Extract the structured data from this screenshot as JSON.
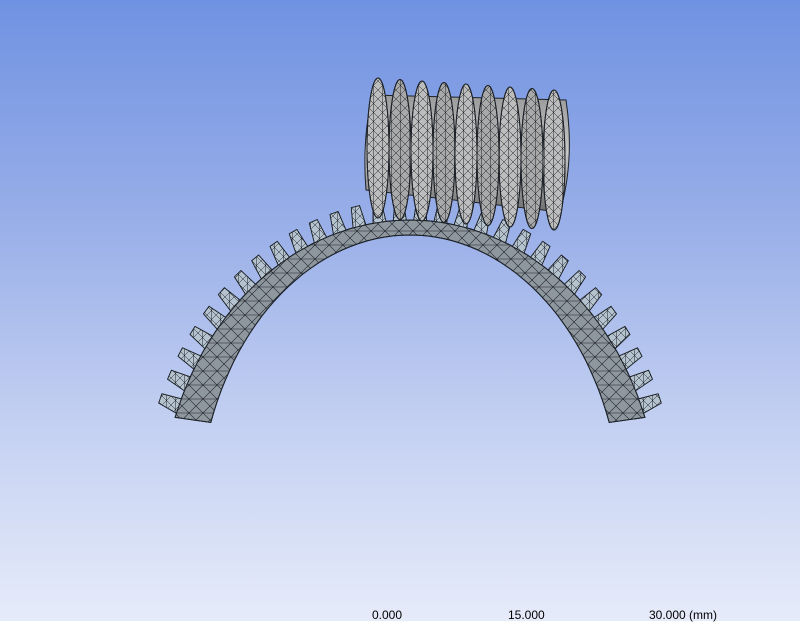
{
  "viewport": {
    "background_top": "#7092e2",
    "background_bottom": "#e6ebfa"
  },
  "model": {
    "gear_color": "#8e969e",
    "gear_tooth_color": "#b5c3cf",
    "worm_color": "#7a7a7a",
    "mesh_line_color": "#1d2228"
  },
  "scale_bar": {
    "label_0": "0.000",
    "label_1": "15.000",
    "label_2": "30.000 (mm)"
  }
}
